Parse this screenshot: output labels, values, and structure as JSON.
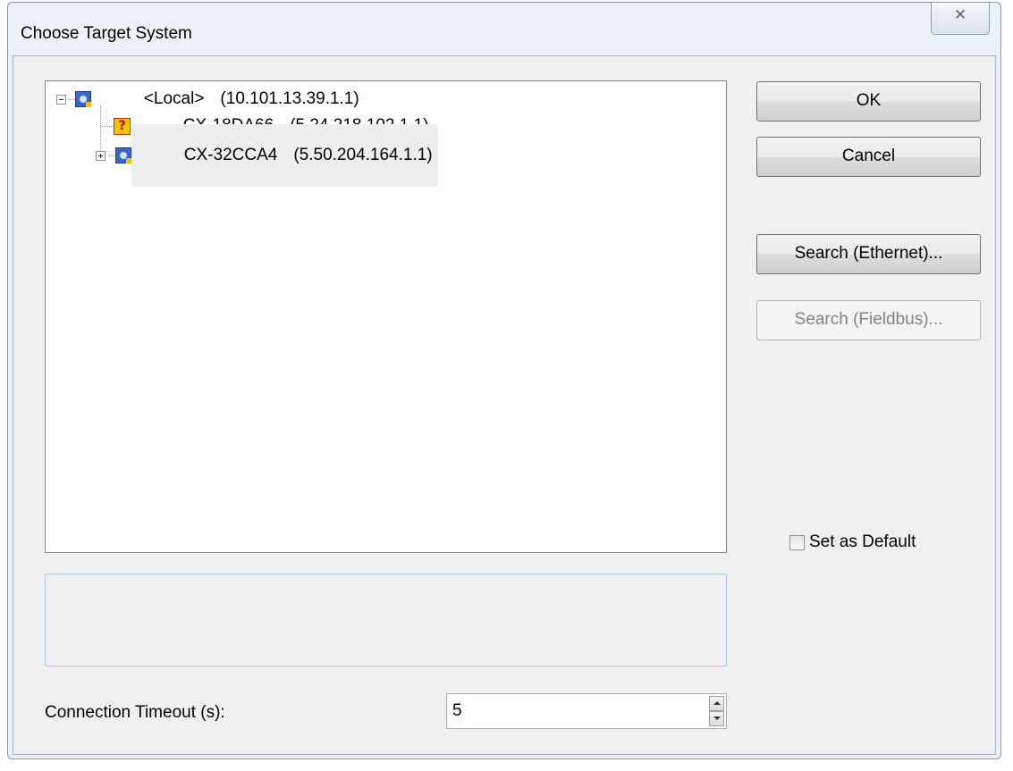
{
  "window": {
    "title": "Choose Target System",
    "close_glyph": "✕"
  },
  "tree": {
    "items": [
      {
        "name": "<Local>",
        "address": "(10.101.13.39.1.1)",
        "icon": "pc-icon",
        "expander": "minus"
      },
      {
        "name": "CX-18DA66",
        "address": "(5.24.218.102.1.1)",
        "icon": "question-icon",
        "expander": "none"
      },
      {
        "name": "CX-32CCA4",
        "address": "(5.50.204.164.1.1)",
        "icon": "pc-icon",
        "expander": "plus",
        "selected": true
      }
    ]
  },
  "buttons": {
    "ok": "OK",
    "cancel": "Cancel",
    "search_ethernet": "Search (Ethernet)...",
    "search_fieldbus": "Search (Fieldbus)..."
  },
  "default_checkbox": {
    "label": "Set as Default",
    "checked": false
  },
  "timeout": {
    "label": "Connection Timeout (s):",
    "value": "5"
  },
  "colors": {
    "dialog_bg": "#f0f0f0",
    "frame_bg": "#ecf1f8",
    "selection": "#eeeeee"
  }
}
